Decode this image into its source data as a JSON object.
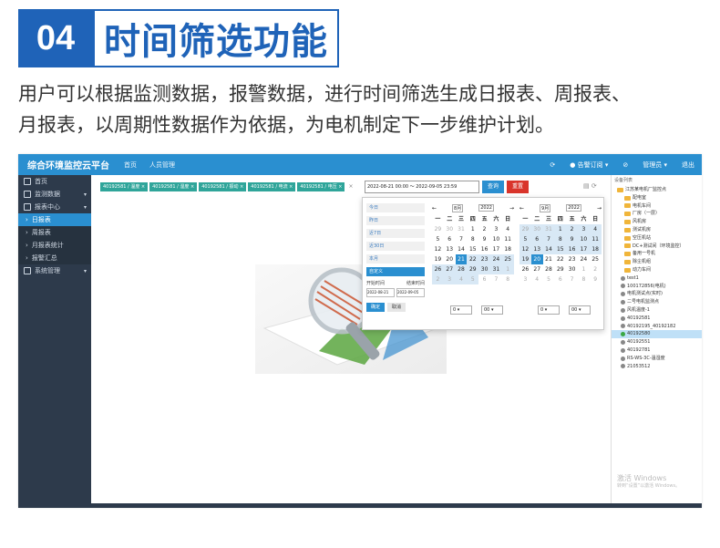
{
  "banner": {
    "number": "04",
    "title": "时间筛选功能"
  },
  "description": {
    "line1": "用户可以根据监测数据，报警数据，进行时间筛选生成日报表、周报表、",
    "line2": "月报表，以周期性数据作为依据，为电机制定下一步维护计划。"
  },
  "app": {
    "title": "综合环境监控云平台",
    "nav": [
      "首页",
      "人员管理"
    ],
    "top_right": [
      "⟳",
      "● 告警订阅 ▾",
      "⊘",
      "管理员 ▾",
      "退出"
    ],
    "sidebar": [
      {
        "label": "首页",
        "sub": false,
        "active": false
      },
      {
        "label": "监测数据",
        "sub": false,
        "active": false
      },
      {
        "label": "报表中心",
        "sub": false,
        "active": false
      },
      {
        "label": "日报表",
        "sub": true,
        "active": true
      },
      {
        "label": "周报表",
        "sub": true,
        "active": false
      },
      {
        "label": "月报表统计",
        "sub": true,
        "active": false
      },
      {
        "label": "报警汇总",
        "sub": true,
        "active": false
      },
      {
        "label": "系统管理",
        "sub": false,
        "active": false
      }
    ],
    "tags": [
      "40192581 / 温度 ×",
      "40192581 / 湿度 ×",
      "40192581 / 振动 ×",
      "40192581 / 电流 ×",
      "40192581 / 电压 ×"
    ],
    "tags_more": "×",
    "date_range": "2022-08-21 00:00 ～ 2022-09-05 23:59",
    "query_button": "查询",
    "reset_button": "重置",
    "table_tools": "▤ ⟳",
    "picker": {
      "ranges": [
        "今日",
        "昨日",
        "近7日",
        "近30日",
        "本月",
        "自定义"
      ],
      "active_range": "自定义",
      "start_label": "开始时间",
      "end_label": "结束时间",
      "start_value": "2022-08-21",
      "end_value": "2022-09-05",
      "ok": "确定",
      "cancel": "取消",
      "weekdays": [
        "一",
        "二",
        "三",
        "四",
        "五",
        "六",
        "日"
      ],
      "left": {
        "month": "8月",
        "year": "2022",
        "days": [
          [
            "29",
            "dim"
          ],
          [
            "30",
            "dim"
          ],
          [
            "31",
            "dim"
          ],
          [
            "1",
            ""
          ],
          [
            "2",
            ""
          ],
          [
            "3",
            ""
          ],
          [
            "4",
            ""
          ],
          [
            "5",
            ""
          ],
          [
            "6",
            ""
          ],
          [
            "7",
            ""
          ],
          [
            "8",
            ""
          ],
          [
            "9",
            ""
          ],
          [
            "10",
            ""
          ],
          [
            "11",
            ""
          ],
          [
            "12",
            ""
          ],
          [
            "13",
            ""
          ],
          [
            "14",
            ""
          ],
          [
            "15",
            ""
          ],
          [
            "16",
            ""
          ],
          [
            "17",
            ""
          ],
          [
            "18",
            ""
          ],
          [
            "19",
            ""
          ],
          [
            "20",
            ""
          ],
          [
            "21",
            "sel"
          ],
          [
            "22",
            "inr"
          ],
          [
            "23",
            "inr"
          ],
          [
            "24",
            "inr"
          ],
          [
            "25",
            "inr"
          ],
          [
            "26",
            "inr"
          ],
          [
            "27",
            "inr"
          ],
          [
            "28",
            "inr"
          ],
          [
            "29",
            "inr"
          ],
          [
            "30",
            "inr"
          ],
          [
            "31",
            "inr"
          ],
          [
            "1",
            "dim inr"
          ],
          [
            "2",
            "dim inr"
          ],
          [
            "3",
            "dim inr"
          ],
          [
            "4",
            "dim inr"
          ],
          [
            "5",
            "dim inr"
          ],
          [
            "6",
            "dim"
          ],
          [
            "7",
            "dim"
          ],
          [
            "8",
            "dim"
          ]
        ]
      },
      "right": {
        "month": "9月",
        "year": "2022",
        "days": [
          [
            "29",
            "dim inr"
          ],
          [
            "30",
            "dim inr"
          ],
          [
            "31",
            "dim inr"
          ],
          [
            "1",
            "inr"
          ],
          [
            "2",
            "inr"
          ],
          [
            "3",
            "inr"
          ],
          [
            "4",
            "inr"
          ],
          [
            "5",
            "inr"
          ],
          [
            "6",
            "inr"
          ],
          [
            "7",
            "inr"
          ],
          [
            "8",
            "inr"
          ],
          [
            "9",
            "inr"
          ],
          [
            "10",
            "inr"
          ],
          [
            "11",
            "inr"
          ],
          [
            "12",
            "inr"
          ],
          [
            "13",
            "inr"
          ],
          [
            "14",
            "inr"
          ],
          [
            "15",
            "inr"
          ],
          [
            "16",
            "inr"
          ],
          [
            "17",
            "inr"
          ],
          [
            "18",
            "inr"
          ],
          [
            "19",
            "inr"
          ],
          [
            "20",
            "sel"
          ],
          [
            "21",
            ""
          ],
          [
            "22",
            ""
          ],
          [
            "23",
            ""
          ],
          [
            "24",
            ""
          ],
          [
            "25",
            ""
          ],
          [
            "26",
            ""
          ],
          [
            "27",
            ""
          ],
          [
            "28",
            ""
          ],
          [
            "29",
            ""
          ],
          [
            "30",
            ""
          ],
          [
            "1",
            "dim"
          ],
          [
            "2",
            "dim"
          ],
          [
            "3",
            "dim"
          ],
          [
            "4",
            "dim"
          ],
          [
            "5",
            "dim"
          ],
          [
            "6",
            "dim"
          ],
          [
            "7",
            "dim"
          ],
          [
            "8",
            "dim"
          ],
          [
            "9",
            "dim"
          ]
        ]
      },
      "time_left": [
        "0 ▾",
        "00 ▾"
      ],
      "time_right": [
        "0 ▾",
        "00 ▾"
      ]
    },
    "tree": {
      "title": "设备列表",
      "nodes": [
        {
          "label": "江苏某电机厂监控点",
          "type": "folder"
        },
        {
          "label": "配电室",
          "type": "folder"
        },
        {
          "label": "电机车间",
          "type": "folder"
        },
        {
          "label": "厂房（一层）",
          "type": "folder"
        },
        {
          "label": "风机房",
          "type": "folder"
        },
        {
          "label": "测试机房",
          "type": "folder"
        },
        {
          "label": "空压机站",
          "type": "folder"
        },
        {
          "label": "DC+测试间（环境监控）",
          "type": "folder"
        },
        {
          "label": "备用一号机",
          "type": "folder"
        },
        {
          "label": "除尘机组",
          "type": "folder"
        },
        {
          "label": "动力车间",
          "type": "folder"
        },
        {
          "label": "test1",
          "type": "dot"
        },
        {
          "label": "100172856(电机)",
          "type": "dot"
        },
        {
          "label": "电机测试点(实时)",
          "type": "dot"
        },
        {
          "label": "二号电机监测点",
          "type": "dot"
        },
        {
          "label": "风机温度-1",
          "type": "dot"
        },
        {
          "label": "40192581",
          "type": "dot"
        },
        {
          "label": "40192195_40192182",
          "type": "dot"
        },
        {
          "label": "40192580",
          "type": "green",
          "highlight": true
        },
        {
          "label": "40192551",
          "type": "dot"
        },
        {
          "label": "40192781",
          "type": "dot"
        },
        {
          "label": "RS-WS-3C-温湿度",
          "type": "dot"
        },
        {
          "label": "21053512",
          "type": "dot"
        }
      ]
    },
    "watermark": {
      "line1": "激活 Windows",
      "line2": "转到“设置”以激活 Windows。"
    }
  },
  "colors": {
    "brand": "#1f63b8",
    "topbar": "#2a8fd0",
    "sidebar": "#2d3a4b",
    "tag": "#2fa59a",
    "danger": "#d9342b"
  }
}
